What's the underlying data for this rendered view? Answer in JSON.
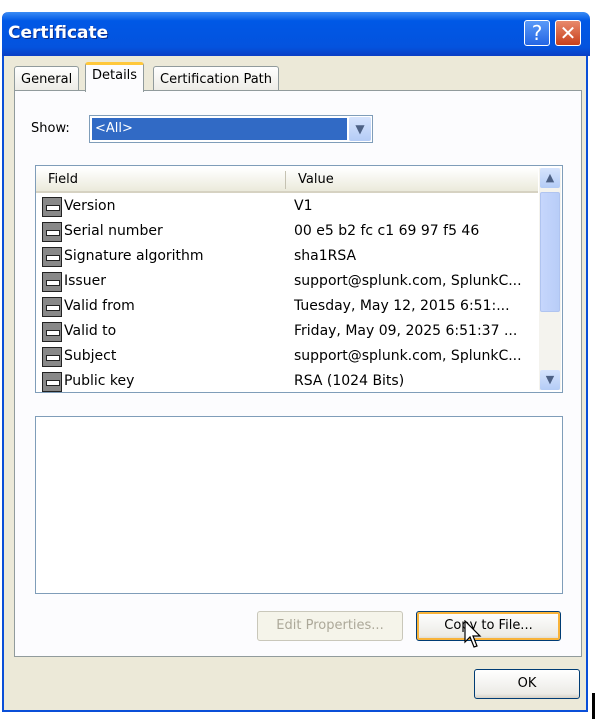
{
  "window": {
    "title": "Certificate",
    "help_label": "?",
    "close_label": "✕"
  },
  "tabs": [
    {
      "label": "General"
    },
    {
      "label": "Details",
      "active": true
    },
    {
      "label": "Certification Path"
    }
  ],
  "show": {
    "label": "Show:",
    "selected": "<All>"
  },
  "list": {
    "columns": [
      "Field",
      "Value"
    ],
    "rows": [
      {
        "field": "Version",
        "value": "V1"
      },
      {
        "field": "Serial number",
        "value": "00 e5 b2 fc c1 69 97 f5 46"
      },
      {
        "field": "Signature algorithm",
        "value": "sha1RSA"
      },
      {
        "field": "Issuer",
        "value": "support@splunk.com, SplunkC..."
      },
      {
        "field": "Valid from",
        "value": "Tuesday, May 12, 2015 6:51:..."
      },
      {
        "field": "Valid to",
        "value": "Friday, May 09, 2025 6:51:37 ..."
      },
      {
        "field": "Subject",
        "value": "support@splunk.com, SplunkC..."
      },
      {
        "field": "Public key",
        "value": "RSA (1024 Bits)"
      }
    ]
  },
  "buttons": {
    "edit_properties": "Edit Properties...",
    "copy_to_file": "Copy to File...",
    "ok": "OK"
  }
}
